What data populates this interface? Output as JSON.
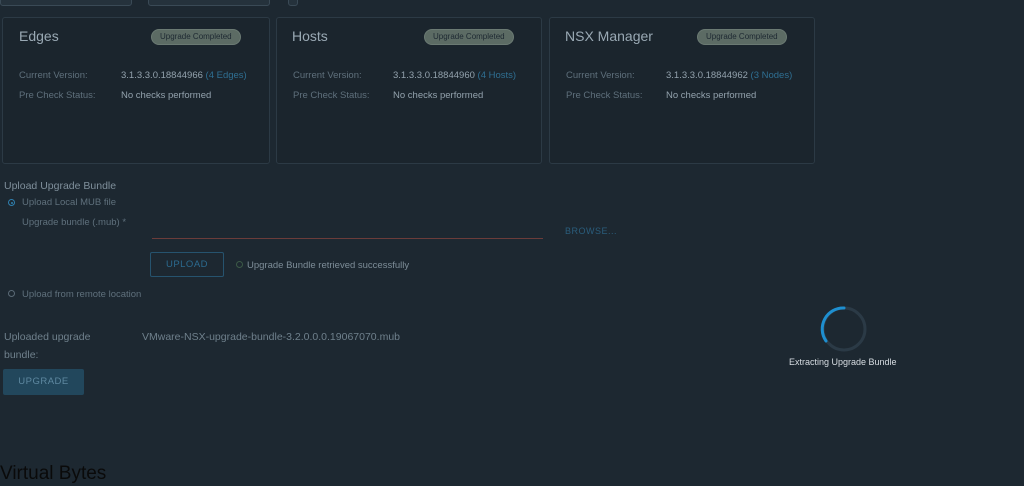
{
  "cards": [
    {
      "title": "Edges",
      "badge": "Upgrade Completed",
      "current_version_label": "Current Version:",
      "current_version": "3.1.3.3.0.18844966",
      "count_link": "(4 Edges)",
      "precheck_label": "Pre Check Status:",
      "precheck_value": "No checks performed"
    },
    {
      "title": "Hosts",
      "badge": "Upgrade Completed",
      "current_version_label": "Current Version:",
      "current_version": "3.1.3.3.0.18844960",
      "count_link": "(4 Hosts)",
      "precheck_label": "Pre Check Status:",
      "precheck_value": "No checks performed"
    },
    {
      "title": "NSX Manager",
      "badge": "Upgrade Completed",
      "current_version_label": "Current Version:",
      "current_version": "3.1.3.3.0.18844962",
      "count_link": "(3 Nodes)",
      "precheck_label": "Pre Check Status:",
      "precheck_value": "No checks performed"
    }
  ],
  "upload": {
    "section_title": "Upload Upgrade Bundle",
    "option_local": "Upload Local MUB file",
    "field_label": "Upgrade bundle (.mub) *",
    "browse_label": "BROWSE...",
    "upload_button": "UPLOAD",
    "status_message": "Upgrade Bundle retrieved successfully",
    "option_remote": "Upload from remote location"
  },
  "uploaded": {
    "label_line1": "Uploaded upgrade",
    "label_line2": "bundle:",
    "filename": "VMware-NSX-upgrade-bundle-3.2.0.0.0.19067070.mub",
    "upgrade_button": "UPGRADE"
  },
  "overlay": {
    "spinner_text": "Extracting Upgrade Bundle",
    "accent_color": "#1e8fd0"
  },
  "watermark": "Virtual Bytes"
}
